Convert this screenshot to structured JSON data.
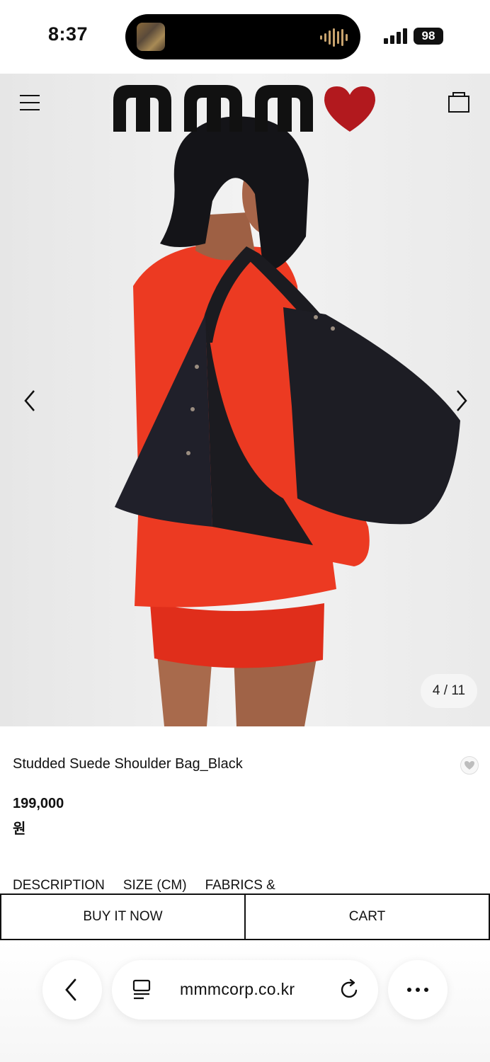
{
  "status_bar": {
    "time": "8:37",
    "battery": "98"
  },
  "product": {
    "image_counter": "4 / 11",
    "title": "Studded Suede Shoulder Bag_Black",
    "price": "199,000",
    "currency": "원",
    "tabs": [
      "DESCRIPTION",
      "SIZE (CM)",
      "FABRICS &"
    ]
  },
  "actions": {
    "buy_now": "BUY IT NOW",
    "cart": "CART"
  },
  "browser": {
    "url": "mmmcorp.co.kr"
  },
  "colors": {
    "heart": "#b2191e",
    "sweater": "#e8351f",
    "bag": "#1b1b20"
  }
}
